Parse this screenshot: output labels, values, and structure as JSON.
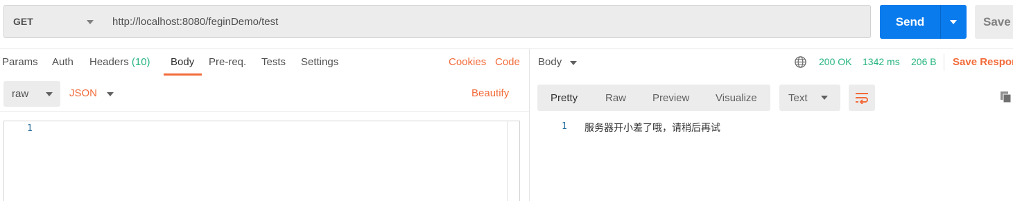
{
  "request": {
    "method": "GET",
    "url": "http://localhost:8080/feginDemo/test",
    "send_label": "Send",
    "save_label": "Save"
  },
  "request_tabs": {
    "params": "Params",
    "auth": "Auth",
    "headers": "Headers",
    "headers_count": "(10)",
    "body": "Body",
    "prereq": "Pre-req.",
    "tests": "Tests",
    "settings": "Settings",
    "cookies": "Cookies",
    "code": "Code",
    "active": "Body"
  },
  "body_options": {
    "mode": "raw",
    "language": "JSON",
    "beautify": "Beautify"
  },
  "editor": {
    "lines": [
      "1"
    ]
  },
  "response": {
    "label": "Body",
    "status": "200 OK",
    "time": "1342 ms",
    "size": "206 B",
    "save_response": "Save Respor",
    "view_tabs": [
      "Pretty",
      "Raw",
      "Preview",
      "Visualize"
    ],
    "active_view": "Pretty",
    "format": "Text",
    "line_number": "1",
    "content": "服务器开小差了哦，请稍后再试"
  },
  "colors": {
    "accent": "#f26b3a",
    "send_blue": "#097bed",
    "success_green": "#26b47f"
  },
  "icons": {
    "globe": "globe-icon",
    "wrap": "wrap-lines-icon",
    "copy": "copy-icon",
    "caret": "chevron-down-icon"
  }
}
